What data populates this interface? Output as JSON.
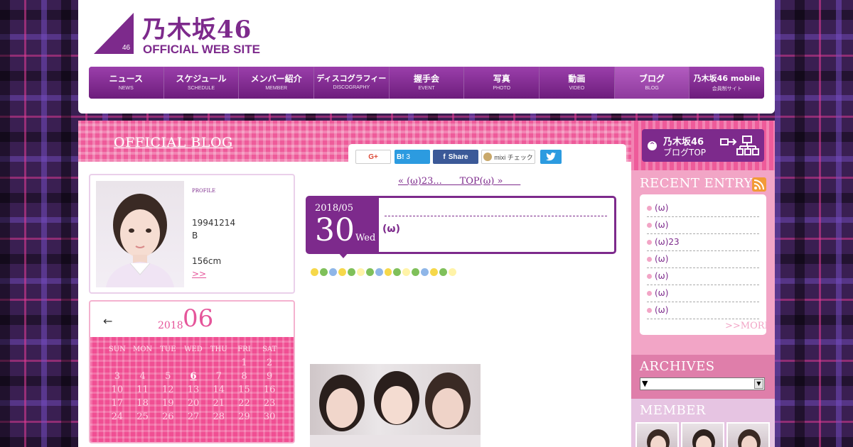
{
  "header": {
    "logo_badge": "46",
    "logo_title": "乃木坂46",
    "logo_subtitle": "OFFICIAL WEB SITE",
    "nav": [
      {
        "jp": "ニュース",
        "en": "NEWS"
      },
      {
        "jp": "スケジュール",
        "en": "SCHEDULE"
      },
      {
        "jp": "メンバー紹介",
        "en": "MEMBER"
      },
      {
        "jp": "ディスコグラフィー",
        "en": "DISCOGRAPHY"
      },
      {
        "jp": "握手会",
        "en": "EVENT"
      },
      {
        "jp": "写真",
        "en": "PHOTO"
      },
      {
        "jp": "動画",
        "en": "VIDEO"
      },
      {
        "jp": "ブログ",
        "en": "BLOG"
      },
      {
        "jp": "乃木坂46 mobile",
        "en": "会員制サイト"
      }
    ],
    "active_nav": "ブログ"
  },
  "blog": {
    "title": "OFFICIAL BLOG",
    "share": {
      "gplus": "G+",
      "hatena": "B!",
      "hatena_count": "3",
      "facebook": "Share",
      "mixi": "mixi チェック",
      "twitter_icon": "twitter-bird-icon"
    }
  },
  "profile": {
    "label": "PROFILE",
    "birthday": "19941214",
    "blood": "B",
    "height": "156cm",
    "more": ">>"
  },
  "calendar": {
    "prev": "←",
    "year": "2018",
    "month": "06",
    "weekdays": [
      "SUN",
      "MON",
      "TUE",
      "WED",
      "THU",
      "FRI",
      "SAT"
    ],
    "weeks": [
      [
        "",
        "",
        "",
        "",
        "",
        "1",
        "2"
      ],
      [
        "3",
        "4",
        "5",
        "6",
        "7",
        "8",
        "9"
      ],
      [
        "10",
        "11",
        "12",
        "13",
        "14",
        "15",
        "16"
      ],
      [
        "17",
        "18",
        "19",
        "20",
        "21",
        "22",
        "23"
      ],
      [
        "24",
        "25",
        "26",
        "27",
        "28",
        "29",
        "30"
      ]
    ],
    "linked_days": [
      "6"
    ]
  },
  "entry": {
    "pager": "« (ω)23...      TOP(ω) »      ",
    "year_month": "2018/05",
    "day": "30",
    "weekday": "Wed",
    "title": "(ω)"
  },
  "sidebar": {
    "top_button_line1": "乃木坂46",
    "top_button_line2": "ブログTOP",
    "recent_title": "RECENT ENTRY",
    "recent": [
      "(ω)",
      "(ω)",
      "(ω)23",
      "(ω)",
      "(ω)",
      "(ω)",
      "(ω)"
    ],
    "recent_more": ">>MORE",
    "archives_title": "ARCHIVES",
    "archives_selected": "▼",
    "member_title": "MEMBER"
  },
  "colors": {
    "brand_purple": "#7d2a8c",
    "pink": "#ee5b9a",
    "light_pink": "#f2a5c6"
  }
}
